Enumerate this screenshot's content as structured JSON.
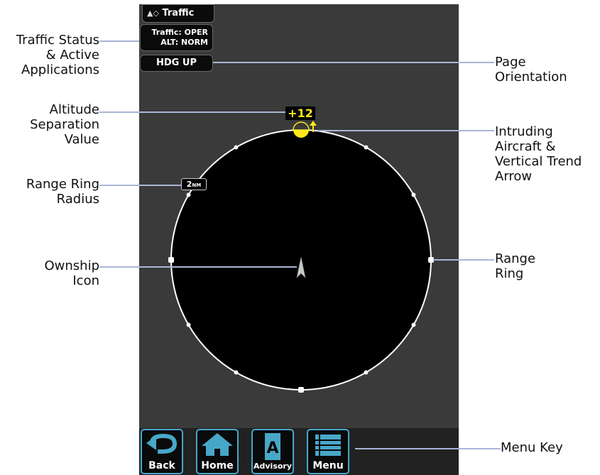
{
  "header": {
    "title": "Traffic"
  },
  "status": {
    "traffic": "Traffic: OPER",
    "alt": "ALT: NORM"
  },
  "orientation": {
    "label": "HDG UP"
  },
  "intruder": {
    "altitude_separation": "+12",
    "trend": "climbing"
  },
  "range_ring": {
    "value": "2",
    "unit": "NM"
  },
  "menu_keys": [
    {
      "label": "Back",
      "icon": "back-arrow-icon"
    },
    {
      "label": "Home",
      "icon": "home-icon"
    },
    {
      "label": "Advisory",
      "icon": "advisory-a-icon"
    },
    {
      "label": "Menu",
      "icon": "menu-list-icon"
    }
  ],
  "callouts": {
    "traffic_status": "Traffic Status\n& Active\nApplications",
    "page_orientation": "Page\nOrientation",
    "altitude_separation": "Altitude\nSeparation\nValue",
    "intruding_aircraft": "Intruding\nAircraft &\nVertical Trend\nArrow",
    "range_ring_radius": "Range Ring\nRadius",
    "ownship_icon": "Ownship\nIcon",
    "range_ring": "Range\nRing",
    "menu_key": "Menu Key"
  },
  "colors": {
    "intruder": "#ffe81a",
    "key_border": "#48a7c8",
    "leader": "#a9b5d6",
    "screen_bg": "#3a3a3a"
  }
}
